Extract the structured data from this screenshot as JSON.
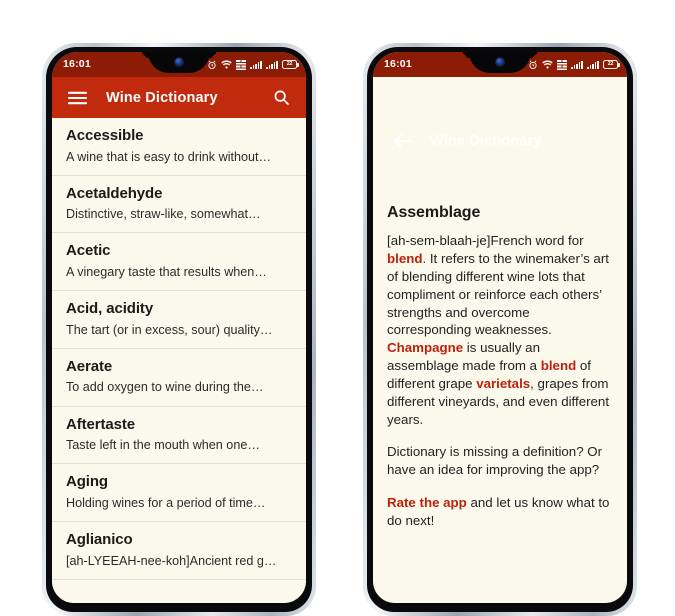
{
  "status_bar": {
    "time": "16:01",
    "icons": [
      "alarm-icon",
      "wifi-icon",
      "mobile-data-icon",
      "signal-bars-icon",
      "signal-bars-icon",
      "battery-icon"
    ],
    "battery_label": "22",
    "background_color": "#8d1c06"
  },
  "theme": {
    "app_bar_color": "#c12a0c",
    "status_bar_color": "#8d1c06",
    "page_background": "#faf9ec",
    "link_color": "#c0200b",
    "text_color": "#1b1b1b"
  },
  "left_phone": {
    "app_bar": {
      "menu_icon": "hamburger-menu-icon",
      "title": "Wine Dictionary",
      "search_icon": "search-icon"
    },
    "entries": [
      {
        "term": "Accessible",
        "description": "A wine that is easy to drink without…"
      },
      {
        "term": "Acetaldehyde",
        "description": "Distinctive, straw-like, somewhat…"
      },
      {
        "term": "Acetic",
        "description": "A vinegary taste that results when…"
      },
      {
        "term": "Acid, acidity",
        "description": "The tart (or in excess, sour) quality…"
      },
      {
        "term": "Aerate",
        "description": "To add oxygen to wine during the…"
      },
      {
        "term": "Aftertaste",
        "description": "Taste left in the mouth when one…"
      },
      {
        "term": "Aging",
        "description": "Holding wines for a period of time…"
      },
      {
        "term": "Aglianico",
        "description": "[ah-LYEEAH-nee-koh]Ancient red g…"
      }
    ]
  },
  "right_phone": {
    "app_bar": {
      "back_icon": "back-arrow-icon",
      "title": "Wine Dictionary"
    },
    "detail": {
      "title": "Assemblage",
      "paragraph1": {
        "part1": "[ah-sem-blaah-je]French word for ",
        "link1": "blend",
        "part2": ". It refers to the winemaker’s art of blending different wine lots that compliment or reinforce each others’ strengths and overcome corresponding weaknesses. ",
        "link2": "Champagne",
        "part3": " is usually an assemblage made from a ",
        "link3": "blend",
        "part4": " of different grape ",
        "link4": "varietals",
        "part5": ", grapes from different vineyards, and even different years."
      },
      "paragraph2": "Dictionary is missing a definition? Or have an idea for improving the app?",
      "paragraph3": {
        "link": "Rate the app",
        "text": " and let us know what to do next!"
      }
    }
  }
}
